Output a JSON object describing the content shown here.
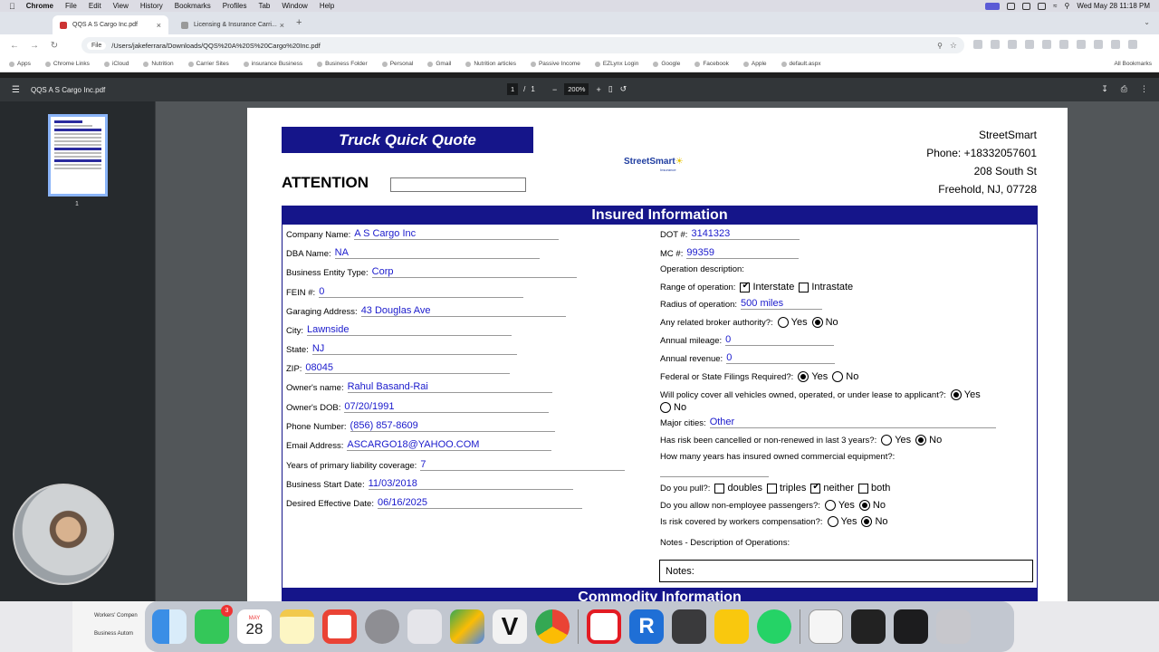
{
  "menubar": {
    "app": "Chrome",
    "items": [
      "File",
      "Edit",
      "View",
      "History",
      "Bookmarks",
      "Profiles",
      "Tab",
      "Window",
      "Help"
    ],
    "clock": "Wed May 28  11:18 PM"
  },
  "tabs": [
    {
      "label": "QQS A S Cargo Inc.pdf",
      "active": true
    },
    {
      "label": "Licensing & Insurance Carri...",
      "active": false
    }
  ],
  "addressbar": {
    "chip": "File",
    "url": "/Users/jakeferrara/Downloads/QQS%20A%20S%20Cargo%20Inc.pdf"
  },
  "bookmarks": {
    "items": [
      "Apps",
      "Chrome Links",
      "iCloud",
      "Nutrition",
      "Carrier Sites",
      "insurance Business",
      "Business Folder",
      "Personal",
      "Gmail",
      "Nutrition articles",
      "Passive Income",
      "EZLynx Login",
      "Google",
      "Facebook",
      "Apple",
      "default.aspx"
    ],
    "all": "All Bookmarks"
  },
  "pdf_toolbar": {
    "file_name": "QQS A S Cargo Inc.pdf",
    "page_current": "1",
    "page_sep": "/",
    "page_total": "1",
    "zoom": "200%"
  },
  "sidebar": {
    "thumb_number": "1"
  },
  "document": {
    "banner": "Truck Quick Quote",
    "attention_label": "ATTENTION",
    "logo_text": "StreetSmart",
    "logo_sub": "Insurance",
    "agency": {
      "name": "StreetSmart",
      "phone": "Phone: +18332057601",
      "street": "208 South St",
      "city": "Freehold, NJ, 07728"
    },
    "section_title": "Insured Information",
    "section2_title": "Commodity Information",
    "left_fields": [
      {
        "label": "Company Name:",
        "value": "A S Cargo Inc"
      },
      {
        "label": "DBA Name:",
        "value": "NA"
      },
      {
        "label": "Business Entity Type:",
        "value": "Corp"
      },
      {
        "label": "FEIN #:",
        "value": "0"
      },
      {
        "label": "Garaging Address:",
        "value": "43 Douglas Ave"
      },
      {
        "label": "City:",
        "value": "Lawnside"
      },
      {
        "label": "State:",
        "value": "NJ"
      },
      {
        "label": "ZIP:",
        "value": "08045"
      },
      {
        "label": "Owner's name:",
        "value": "Rahul Basand-Rai"
      },
      {
        "label": "Owner's DOB:",
        "value": "07/20/1991"
      },
      {
        "label": "Phone Number:",
        "value": "(856) 857-8609"
      },
      {
        "label": "Email Address:",
        "value": "ASCARGO18@YAHOO.COM"
      },
      {
        "label": "Years of primary liability coverage:",
        "value": "7"
      },
      {
        "label": "Business Start Date:",
        "value": "11/03/2018"
      },
      {
        "label": "Desired Effective Date:",
        "value": "06/16/2025"
      }
    ],
    "right": {
      "dot_label": "DOT #:",
      "dot_value": "3141323",
      "mc_label": "MC #:",
      "mc_value": "99359",
      "op_desc_label": "Operation description:",
      "range_label": "Range of operation:",
      "range_interstate": "Interstate",
      "range_intrastate": "Intrastate",
      "radius_label": "Radius of operation:",
      "radius_value": "500 miles",
      "broker_label": "Any related broker authority?:",
      "mileage_label": "Annual mileage:",
      "mileage_value": "0",
      "revenue_label": "Annual revenue:",
      "revenue_value": "0",
      "filings_label": "Federal or State Filings Required?:",
      "cover_label": "Will policy cover all vehicles owned, operated, or under lease to applicant?:",
      "cities_label": "Major cities:",
      "cities_value": "Other",
      "cancelled_label": "Has risk been cancelled or non-renewed in last 3 years?:",
      "years_equip_label": "How many years has insured owned commercial equipment?:",
      "pull_label": "Do you pull?:",
      "pull_doubles": "doubles",
      "pull_triples": "triples",
      "pull_neither": "neither",
      "pull_both": "both",
      "passengers_label": "Do you allow non-employee passengers?:",
      "workers_label": "Is risk covered by workers compensation?:",
      "notes_desc_label": "Notes - Description of Operations:",
      "notes_box_label": "Notes:",
      "yes": "Yes",
      "no": "No"
    }
  },
  "dock": {
    "mini_lines": [
      "Workers' Compen",
      "Business Autom"
    ],
    "calendar_month": "MAY",
    "calendar_day": "28",
    "messages_badge": "3"
  }
}
